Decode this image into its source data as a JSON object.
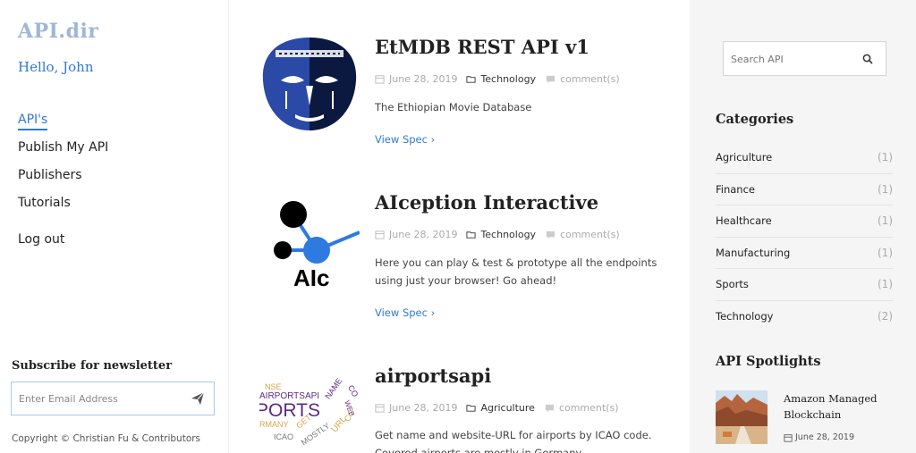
{
  "brand": {
    "logo": "API.dir",
    "greeting": "Hello, John"
  },
  "nav": {
    "items": [
      {
        "label": "API's",
        "active": true
      },
      {
        "label": "Publish My API",
        "active": false
      },
      {
        "label": "Publishers",
        "active": false
      },
      {
        "label": "Tutorials",
        "active": false
      }
    ],
    "logout": "Log out"
  },
  "newsletter": {
    "title": "Subscribe for newsletter",
    "placeholder": "Enter Email Address",
    "icon": "send-icon"
  },
  "copyright": "Copyright © Christian Fu & Contributors",
  "posts": [
    {
      "title": "EtMDB REST API v1",
      "date": "June 28, 2019",
      "category": "Technology",
      "comments": "comment(s)",
      "description": "The Ethiopian Movie Database",
      "link": "View Spec ›",
      "thumb": "mask-logo"
    },
    {
      "title": "AIception Interactive",
      "date": "June 28, 2019",
      "category": "Technology",
      "comments": "comment(s)",
      "description": "Here you can play & test & prototype all the endpoints using just your browser! Go ahead!",
      "link": "View Spec ›",
      "thumb": "network-logo",
      "thumb_text": "AIc"
    },
    {
      "title": "airportsapi",
      "date": "June 28, 2019",
      "category": "Agriculture",
      "comments": "comment(s)",
      "description": "Get name and website-URL for airports by ICAO code. Covered airports are mostly in Germany.",
      "thumb": "word-cloud",
      "thumb_words": [
        "NSE",
        "AIRPORTSAPI",
        "NAME",
        "CO",
        "PORTS",
        "WEB",
        "RMANY",
        "GET",
        "ICAO",
        "MOSTLY",
        "URL",
        "CO"
      ]
    }
  ],
  "search": {
    "placeholder": "Search API",
    "icon": "search-icon"
  },
  "categories": {
    "title": "Categories",
    "items": [
      {
        "name": "Agriculture",
        "count": "(1)"
      },
      {
        "name": "Finance",
        "count": "(1)"
      },
      {
        "name": "Healthcare",
        "count": "(1)"
      },
      {
        "name": "Manufacturing",
        "count": "(1)"
      },
      {
        "name": "Sports",
        "count": "(1)"
      },
      {
        "name": "Technology",
        "count": "(2)"
      }
    ]
  },
  "spotlights": {
    "title": "API Spotlights",
    "item": {
      "title": "Amazon Managed Blockchain",
      "date": "June 28, 2019"
    }
  },
  "colors": {
    "accent": "#2e7ad7",
    "logo": "#9eb7d8",
    "sidebar_bg": "#f5f5f5"
  }
}
